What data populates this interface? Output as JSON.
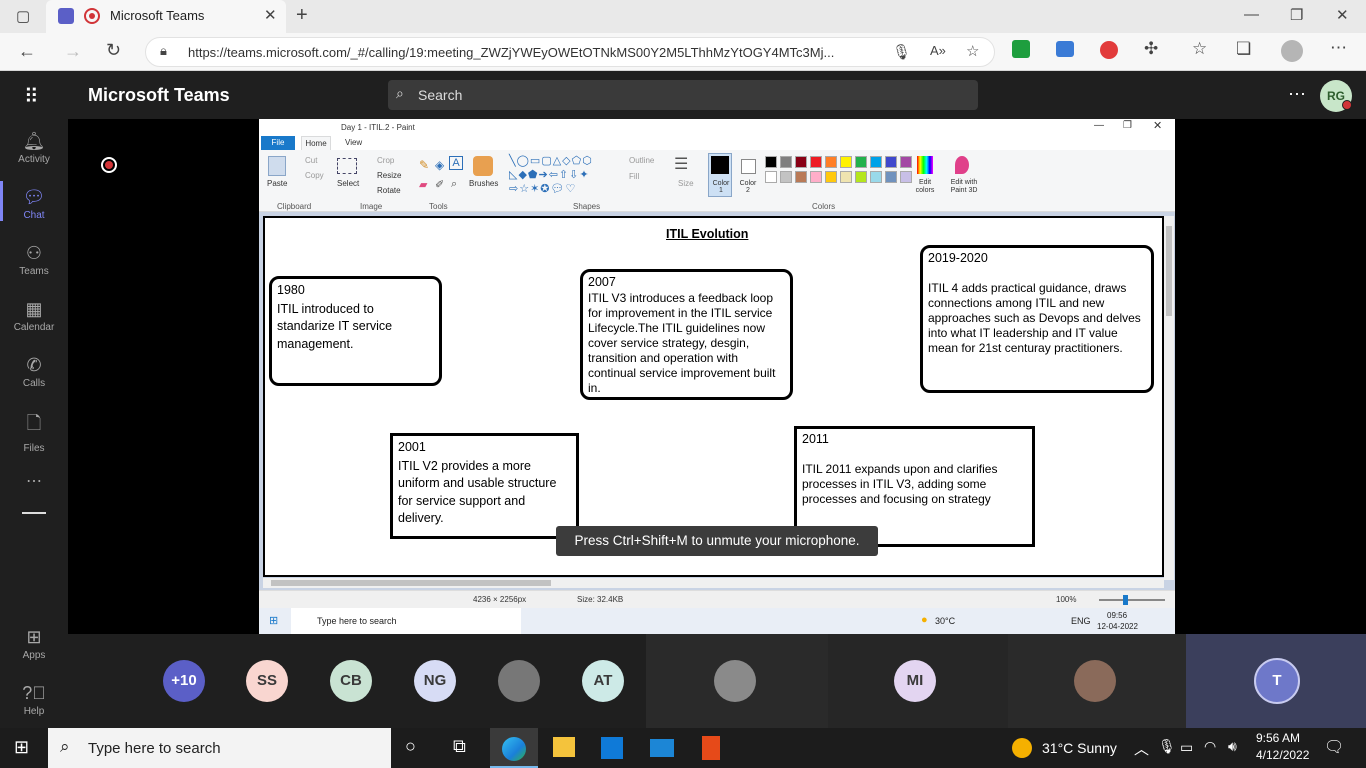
{
  "browser": {
    "tab_title": "Microsoft Teams",
    "url": "https://teams.microsoft.com/_#/calling/19:meeting_ZWZjYWEyOWEtOTNkMS00Y2M5LThhMzYtOGY4MTc3Mj..."
  },
  "teams": {
    "app_name": "Microsoft Teams",
    "search_placeholder": "Search",
    "user_initials": "RG",
    "rail": [
      "Activity",
      "Chat",
      "Teams",
      "Calendar",
      "Calls",
      "Files",
      "Apps",
      "Help"
    ]
  },
  "paint": {
    "title": "Day 1 - ITIL.2 - Paint",
    "menu": [
      "File",
      "Home",
      "View"
    ],
    "ribbon": {
      "paste": "Paste",
      "cut": "Cut",
      "copy": "Copy",
      "select": "Select",
      "crop": "Crop",
      "resize": "Resize",
      "rotate": "Rotate",
      "brushes": "Brushes",
      "outline": "Outline",
      "fill": "Fill",
      "size": "Size",
      "color1": "Color 1",
      "color2": "Color 2",
      "edit_colors": "Edit colors",
      "edit_paint3d": "Edit with Paint 3D"
    },
    "groups": [
      "Clipboard",
      "Image",
      "Tools",
      "Shapes",
      "Colors"
    ],
    "palette": [
      "#000000",
      "#7f7f7f",
      "#880015",
      "#ed1c24",
      "#ff7f27",
      "#fff200",
      "#22b14c",
      "#00a2e8",
      "#3f48cc",
      "#a349a4",
      "#ffffff",
      "#c3c3c3",
      "#b97a57",
      "#ffaec9",
      "#ffc90e",
      "#efe4b0",
      "#b5e61d",
      "#99d9ea",
      "#7092be",
      "#c8bfe7"
    ],
    "status": {
      "dimensions": "4236 × 2256px",
      "size": "Size: 32.4KB",
      "zoom": "100%"
    }
  },
  "slide": {
    "title": "ITIL Evolution",
    "boxes": [
      {
        "year": "1980",
        "text": "ITIL introduced to standarize IT service management."
      },
      {
        "year": "2007",
        "text": "ITIL V3 introduces a feedback loop for improvement in the ITIL service Lifecycle.The ITIL guidelines now cover service strategy, desgin, transition and operation with continual service improvement built in."
      },
      {
        "year": "2019-2020",
        "text": "ITIL 4 adds practical guidance, draws connections among ITIL and new approaches such as Devops and delves into what IT leadership and IT value mean for 21st centuray practitioners."
      },
      {
        "year": "2001",
        "text": "ITIL V2 provides a more uniform and usable structure for service support and delivery."
      },
      {
        "year": "2011",
        "text": "ITIL 2011 expands upon and clarifies processes in ITIL V3, adding some processes and focusing on strategy"
      }
    ]
  },
  "inner_taskbar": {
    "search": "Type here to search",
    "temp": "30°C",
    "lang": "ENG",
    "time": "09:56",
    "date": "12-04-2022"
  },
  "toast": "Press Ctrl+Shift+M to unmute your microphone.",
  "participants": [
    {
      "initials": "+10",
      "color": "#5b5fc7",
      "text_color": "#ffffff"
    },
    {
      "initials": "SS",
      "color": "#f9d6d0"
    },
    {
      "initials": "CB",
      "color": "#c9e3d3"
    },
    {
      "initials": "NG",
      "color": "#d7dcf5"
    },
    {
      "initials": "",
      "color": "#777777"
    },
    {
      "initials": "AT",
      "color": "#cdeae7"
    },
    {
      "initials": "",
      "color": "#8a8a8a"
    },
    {
      "initials": "MI",
      "color": "#e3d5f1"
    },
    {
      "initials": "",
      "color": "#8a6a5a"
    },
    {
      "initials": "T",
      "color": "#6e78c9",
      "text_color": "#ffffff"
    }
  ],
  "taskbar": {
    "search": "Type here to search",
    "weather": "31°C  Sunny",
    "time": "9:56 AM",
    "date": "4/12/2022"
  }
}
